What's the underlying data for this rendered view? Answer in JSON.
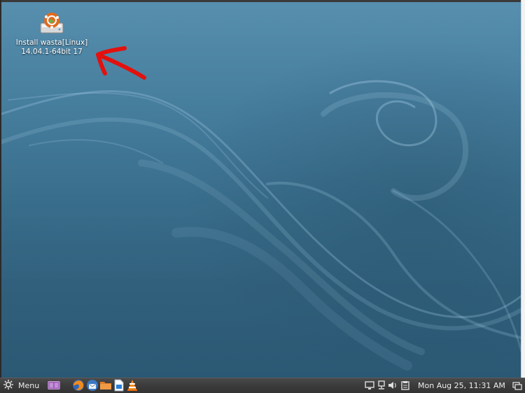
{
  "desktop": {
    "icons": [
      {
        "label_line1": "Install wasta[Linux]",
        "label_line2": "14.04.1-64bit 17",
        "icon": "install-drive-icon"
      }
    ],
    "annotation": {
      "icon": "red-arrow-icon",
      "color": "#e3110e"
    }
  },
  "taskbar": {
    "menu_label": "Menu",
    "menu_icon": "gear-icon",
    "launchers": [
      {
        "icon": "workspace-switcher-icon"
      },
      {
        "icon": "firefox-icon"
      },
      {
        "icon": "thunderbird-icon"
      },
      {
        "icon": "files-folder-icon"
      },
      {
        "icon": "libreoffice-writer-icon"
      },
      {
        "icon": "vlc-icon"
      }
    ],
    "tray": [
      {
        "icon": "display-icon"
      },
      {
        "icon": "network-icon"
      },
      {
        "icon": "volume-icon"
      },
      {
        "icon": "clipboard-icon"
      }
    ],
    "clock": "Mon Aug 25, 11:31 AM",
    "show_desktop_icon": "show-desktop-icon"
  },
  "colors": {
    "wallpaper": "#2f6684",
    "taskbar": "#3b3b3b",
    "arrow": "#e3110e"
  }
}
